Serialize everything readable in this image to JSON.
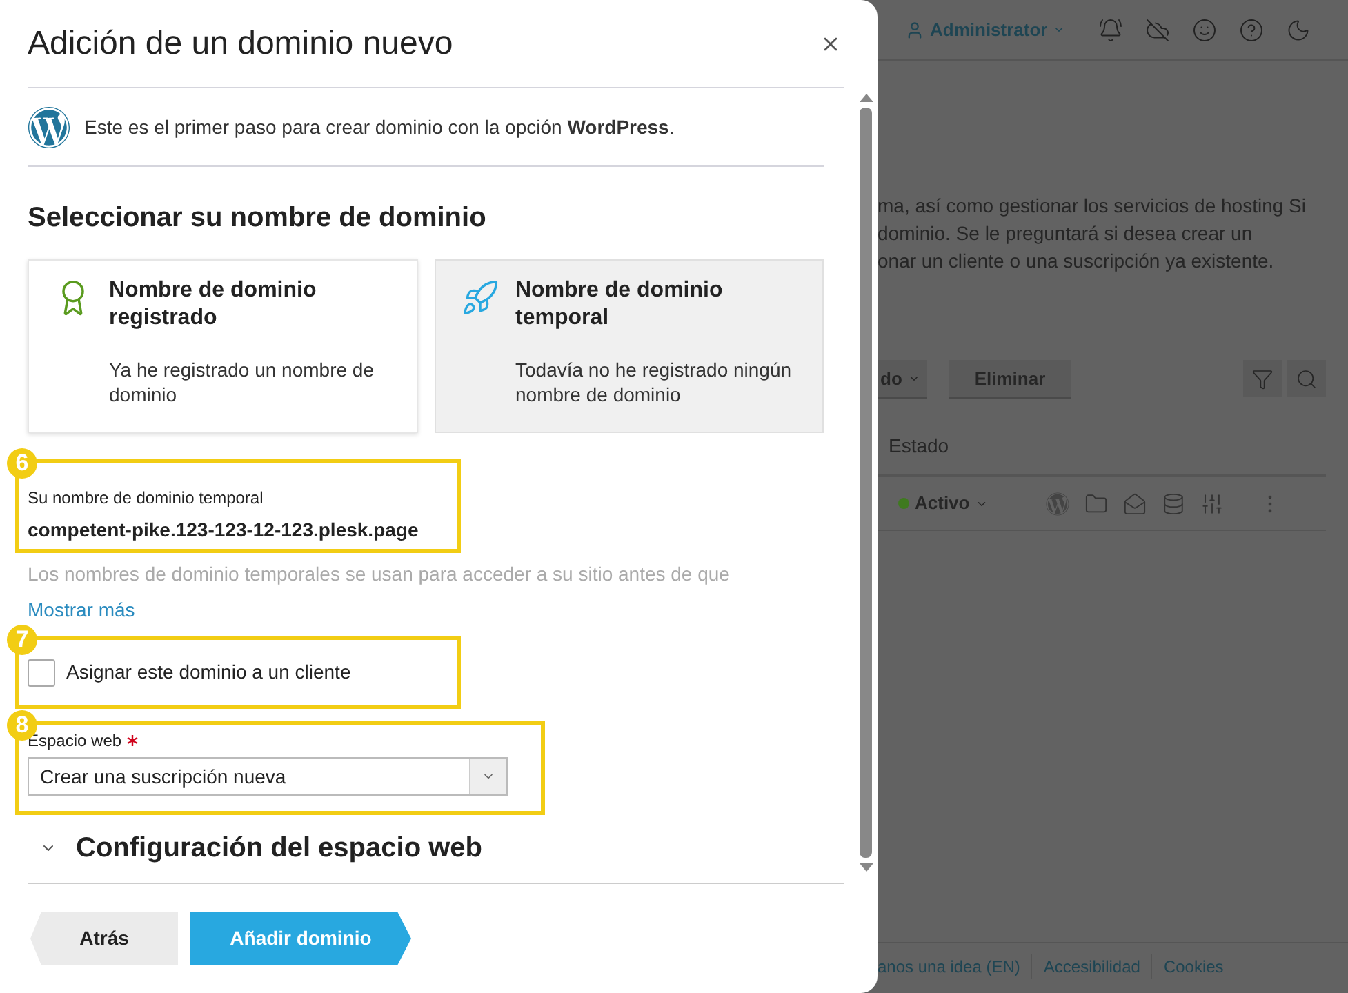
{
  "dialog": {
    "title": "Adición de un dominio nuevo",
    "intro": "Este es el primer paso para crear dominio con la opción **WordPress**.",
    "section_title": "Seleccionar su nombre de dominio",
    "options": [
      {
        "kind": "registered",
        "title": "Nombre de dominio registrado",
        "description": "Ya he registrado un nombre de dominio",
        "selected": false
      },
      {
        "kind": "temporary",
        "title": "Nombre de dominio temporal",
        "description": "Todavía no he registrado ningún nombre de dominio",
        "selected": true
      }
    ],
    "temp_domain": {
      "callout": "6",
      "label": "Su nombre de dominio temporal",
      "value": "competent-pike.123-123-12-123.plesk.page"
    },
    "hint": "Los nombres de dominio temporales se usan para acceder a su sitio antes de que",
    "show_more": "Mostrar más",
    "assign_client": {
      "callout": "7",
      "label": "Asignar este dominio a un cliente",
      "checked": false
    },
    "webspace": {
      "callout": "8",
      "label": "Espacio web",
      "required": true,
      "value": "Crear una suscripción nueva"
    },
    "settings_section": {
      "title": "Configuración del espacio web",
      "expanded": false
    },
    "buttons": [
      {
        "kind": "back",
        "label": "Atrás"
      },
      {
        "kind": "primary",
        "label": "Añadir dominio"
      }
    ]
  },
  "background": {
    "user": "Administrator",
    "description_lines": [
      "ma, así como gestionar los servicios de hosting Si",
      "dominio. Se le preguntará si desea crear un",
      "onar un cliente o una suscripción ya existente."
    ],
    "toolbar_buttons": [
      "do",
      "Eliminar"
    ],
    "column": "Estado",
    "row_status": {
      "label": "Activo",
      "color": "#3f7a1f"
    },
    "footer_links": [
      "anos una idea (EN)",
      "Accesibilidad",
      "Cookies"
    ]
  }
}
